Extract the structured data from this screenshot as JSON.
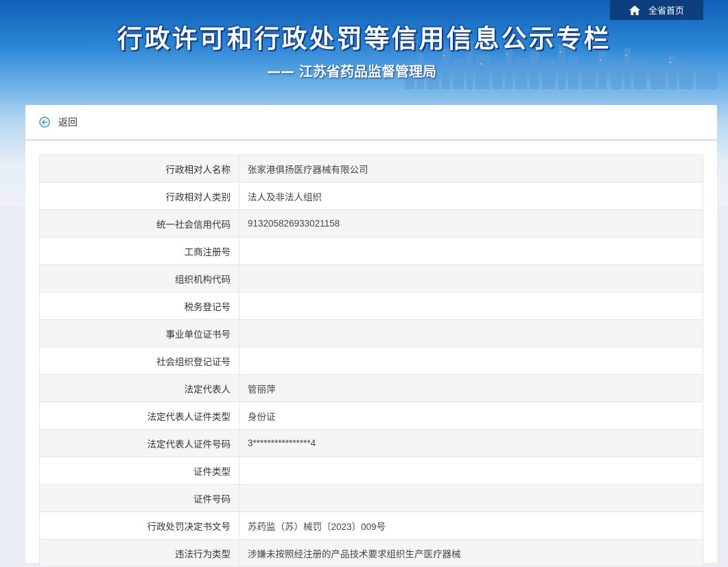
{
  "header": {
    "title": "行政许可和行政处罚等信用信息公示专栏",
    "subtitle": "—— 江苏省药品监督管理局",
    "home_link": "全省首页"
  },
  "nav": {
    "back_label": "返回"
  },
  "details": [
    {
      "label": "行政相对人名称",
      "value": "张家港俱扬医疗器械有限公司"
    },
    {
      "label": "行政相对人类别",
      "value": "法人及非法人组织"
    },
    {
      "label": "统一社会信用代码",
      "value": "913205826933021158"
    },
    {
      "label": "工商注册号",
      "value": ""
    },
    {
      "label": "组织机构代码",
      "value": ""
    },
    {
      "label": "税务登记号",
      "value": ""
    },
    {
      "label": "事业单位证书号",
      "value": ""
    },
    {
      "label": "社会组织登记证号",
      "value": ""
    },
    {
      "label": "法定代表人",
      "value": "管丽萍"
    },
    {
      "label": "法定代表人证件类型",
      "value": "身份证"
    },
    {
      "label": "法定代表人证件号码",
      "value": "3****************4"
    },
    {
      "label": "证件类型",
      "value": ""
    },
    {
      "label": "证件号码",
      "value": ""
    },
    {
      "label": "行政处罚决定书文号",
      "value": "苏药监（苏）械罚〔2023〕009号"
    },
    {
      "label": "违法行为类型",
      "value": "涉嫌未按照经注册的产品技术要求组织生产医疗器械"
    }
  ],
  "colors": {
    "header_blue": "#1a6fc4",
    "home_bar": "#0d3f7e",
    "back_icon": "#3b9be0"
  },
  "icons": {
    "home": "home-icon",
    "back": "back-circle-arrow-icon"
  }
}
